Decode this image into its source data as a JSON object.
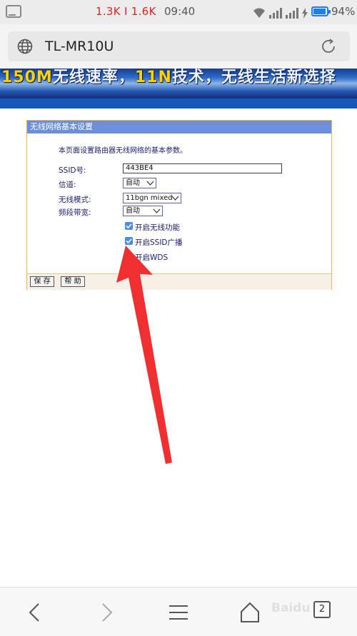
{
  "status_bar": {
    "speed": "1.3K I 1.6K",
    "time": "09:40",
    "battery": "94%",
    "colors": {
      "speed": "#e02020",
      "battery": "#1e7ef0"
    }
  },
  "browser": {
    "address": "TL-MR10U"
  },
  "banner": {
    "text_yellow_1": "150M",
    "text_white_1": "无线速率，",
    "text_yellow_2": "11N",
    "text_white_2": "技术，无线生活新选择"
  },
  "panel": {
    "title": "无线网络基本设置",
    "description": "本页面设置路由器无线网络的基本参数。",
    "ssid_label": "SSID号:",
    "ssid_value": "443BE4",
    "channel_label": "信道:",
    "channel_value": "自动",
    "mode_label": "无线模式:",
    "mode_value": "11bgn mixed",
    "bandwidth_label": "频段带宽:",
    "bandwidth_value": "自动",
    "checkbox_wireless": "开启无线功能",
    "checkbox_ssid": "开启SSID广播",
    "checkbox_wds": "开启WDS",
    "save_button": "保 存",
    "help_button": "帮 助"
  },
  "bottom_nav": {
    "tab_count": "2"
  },
  "watermark": "Baidu"
}
